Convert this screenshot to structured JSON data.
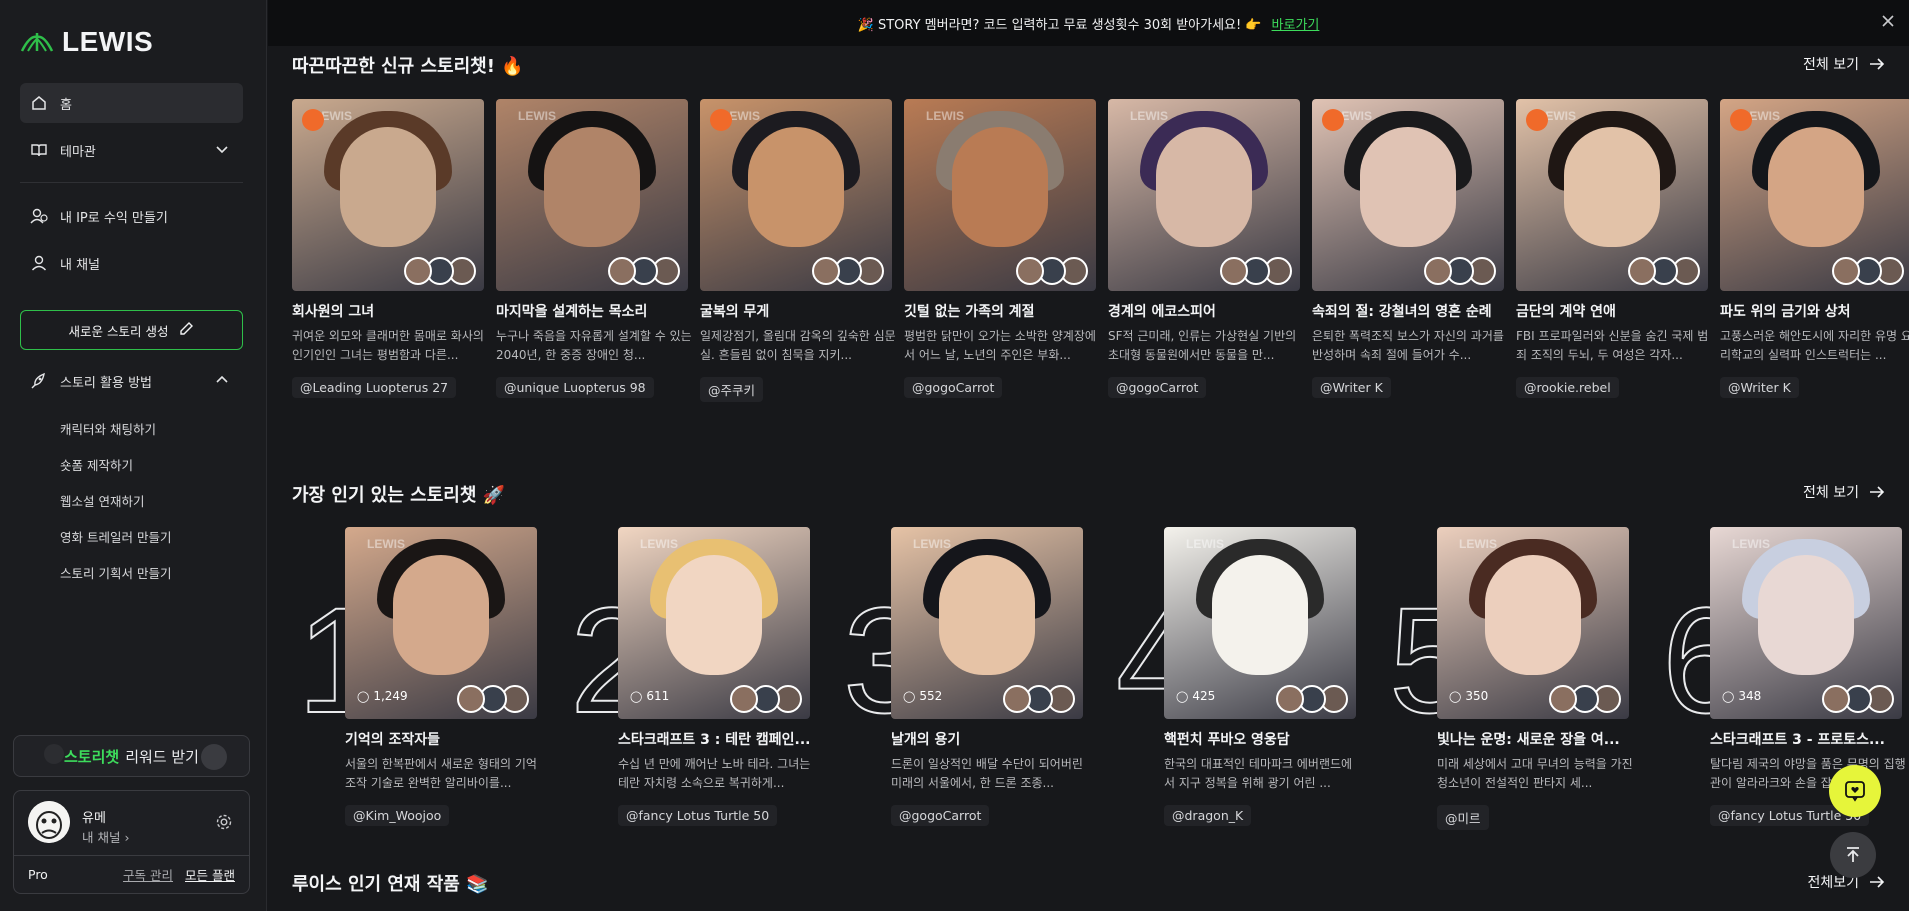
{
  "brand": {
    "name": "LEWIS"
  },
  "banner": {
    "text": "🎉 STORY 멤버라면? 코드 입력하고 무료 생성횟수 30회 받아가세요! 👉",
    "link": "바로가기"
  },
  "sidebar": {
    "home": "홈",
    "theme": "테마관",
    "monetize": "내 IP로 수익 만들기",
    "channel": "내 채널",
    "create": "새로운 스토리 생성",
    "howto": "스토리 활용 방법",
    "howto_items": [
      "캐릭터와 채팅하기",
      "숏폼 제작하기",
      "웹소설 연재하기",
      "영화 트레일러 만들기",
      "스토리 기획서 만들기"
    ],
    "review": {
      "highlight": "스토리챗",
      "rest": "리워드 받기"
    },
    "profile": {
      "name": "유메",
      "channel": "내 채널",
      "plan": "Pro",
      "manage": "구독 관리",
      "all_plans": "모든 플랜"
    }
  },
  "sections": {
    "new": {
      "title": "따끈따끈한 신규 스토리챗! 🔥",
      "view_all": "전체 보기"
    },
    "popular": {
      "title": "가장 인기 있는 스토리챗 🚀",
      "view_all": "전체 보기"
    },
    "series": {
      "title": "루이스 인기 연재 작품 📚",
      "view_all": "전체보기"
    }
  },
  "new_cards": [
    {
      "title": "회사원의 그녀",
      "desc": "귀여운 외모와 클래머한 몸매로 화사의 인기인인 그녀는 평범함과 다른...",
      "author": "@Leading Luopterus 27",
      "color": "#c9a98e",
      "hair": "#5a3a28"
    },
    {
      "title": "마지막을 설계하는 목소리",
      "desc": "누구나 죽음을 자유롭게 설계할 수 있는 2040년, 한 중증 장애인 청...",
      "author": "@unique Luopterus 98",
      "color": "#b08468",
      "hair": "#151313"
    },
    {
      "title": "굴복의 무게",
      "desc": "일제강점기, 올림대 감옥의 깊숙한 심문실. 흔들림 없이 침묵을 지키...",
      "author": "@주쿠키",
      "color": "#c8936a",
      "hair": "#1c1b20"
    },
    {
      "title": "깃털 없는 가족의 계절",
      "desc": "평범한 닭만이 오가는 소박한 양계장에서 어느 날, 노년의 주인은 부화...",
      "author": "@gogoCarrot",
      "color": "#b97b54",
      "hair": "#8a7c70"
    },
    {
      "title": "경계의 에코스피어",
      "desc": "SF적 근미래, 인류는 가상현실 기반의 초대형 동물원에서만 동물을 만...",
      "author": "@gogoCarrot",
      "color": "#d7b8a6",
      "hair": "#3b2b55"
    },
    {
      "title": "속죄의 절: 강철녀의 영혼 순례",
      "desc": "은퇴한 폭력조직 보스가 자신의 과거를 반성하며 속죄 절에 들어가 수...",
      "author": "@Writer K",
      "color": "#e0c3b4",
      "hair": "#1a1a1c"
    },
    {
      "title": "금단의 계약 연애",
      "desc": "FBI 프로파일러와 신분을 숨긴 국제 범죄 조직의 두뇌, 두 여성은 각자...",
      "author": "@rookie.rebel",
      "color": "#e2c2a8",
      "hair": "#1f1714"
    },
    {
      "title": "파도 위의 금기와 상처",
      "desc": "고풍스러운 해안도시에 자리한 유명 요리학교의 실력파 인스트럭터는 ...",
      "author": "@Writer K",
      "color": "#d4a585",
      "hair": "#14161a"
    }
  ],
  "popular_cards": [
    {
      "rank": "1",
      "count": "1,249",
      "title": "기억의 조작자들",
      "desc": "서울의 한복판에서 새로운 형태의 기억 조작 기술로 완벽한 알리바이를...",
      "author": "@Kim_Woojoo",
      "color": "#d4a98c",
      "hair": "#1a1615"
    },
    {
      "rank": "2",
      "count": "611",
      "title": "스타크래프트 3 : 테란 캠페인...",
      "desc": "수십 년 만에 깨어난 노바 테라. 그녀는 테란 자치령 소속으로 복귀하게...",
      "author": "@fancy Lotus Turtle 50",
      "color": "#f1d6c2",
      "hair": "#e8c072"
    },
    {
      "rank": "3",
      "count": "552",
      "title": "날개의 용기",
      "desc": "드론이 일상적인 배달 수단이 되어버린 미래의 서울에서, 한 드론 조종...",
      "author": "@gogoCarrot",
      "color": "#e6c3a6",
      "hair": "#15161b"
    },
    {
      "rank": "4",
      "count": "425",
      "title": "핵펀치 푸바오 영웅담",
      "desc": "한국의 대표적인 테마파크 에버랜드에서 지구 정복을 위해 광기 어린 ...",
      "author": "@dragon_K",
      "color": "#f4f2ec",
      "hair": "#2a2a2a"
    },
    {
      "rank": "5",
      "count": "350",
      "title": "빛나는 운명: 새로운 장을 여...",
      "desc": "미래 세상에서 고대 무녀의 능력을 가진 청소년이 전설적인 판타지 세...",
      "author": "@미르",
      "color": "#eccfbd",
      "hair": "#4a2b22"
    },
    {
      "rank": "6",
      "count": "348",
      "title": "스타크래프트 3 - 프로토스...",
      "desc": "탈다림 제국의 야망을 품은 무명의 집행관이 알라라크와 손을 잡고 ...",
      "author": "@fancy Lotus Turtle 50",
      "color": "#e8d8d4",
      "hair": "#c8cfe0"
    }
  ]
}
